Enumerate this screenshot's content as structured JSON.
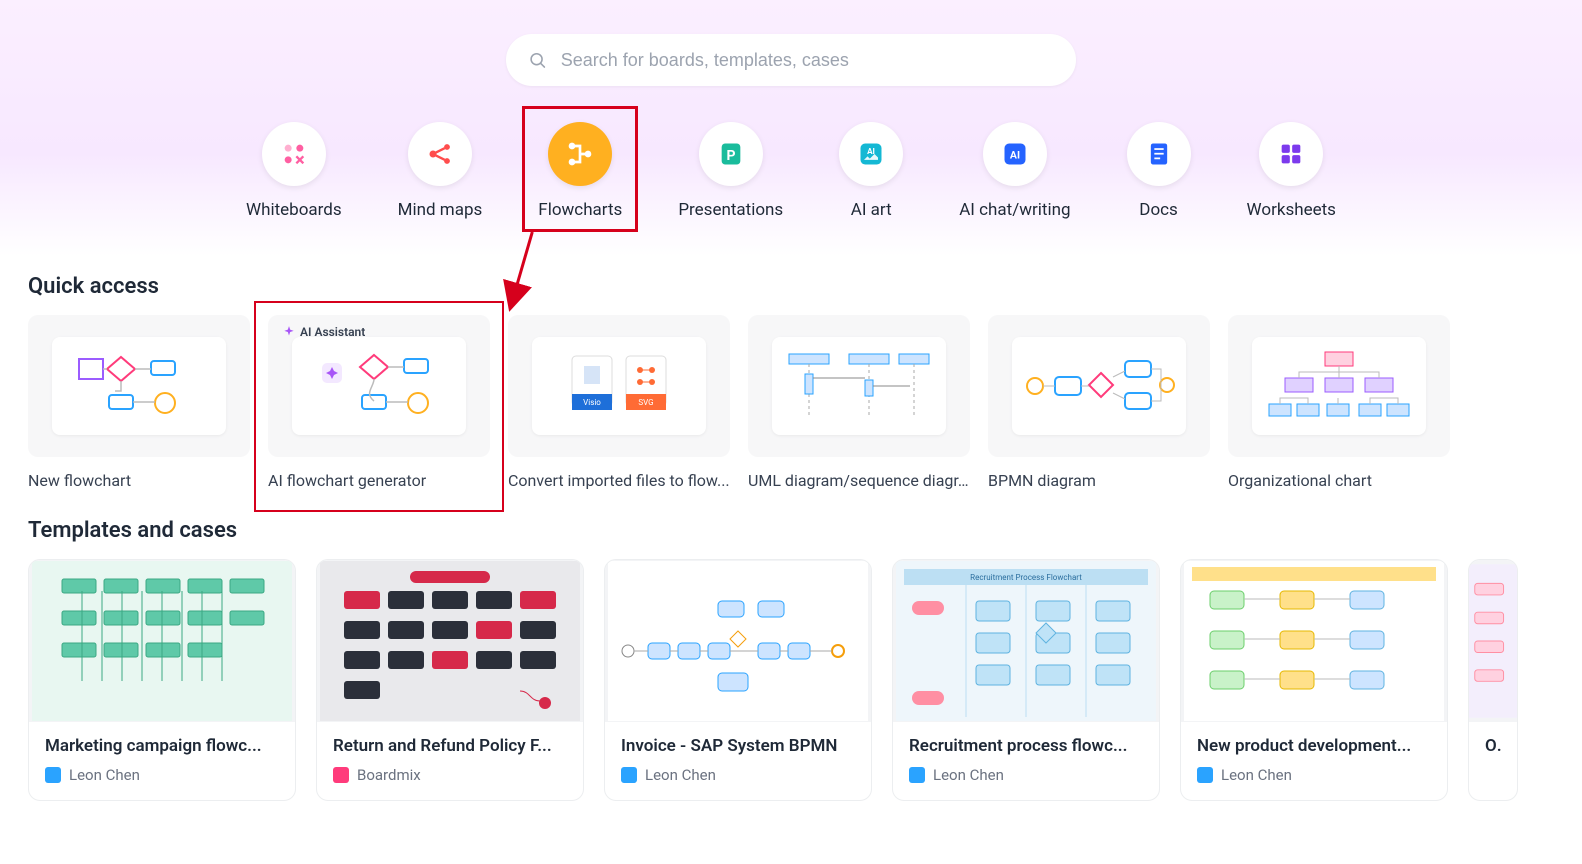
{
  "search": {
    "placeholder": "Search for boards, templates, cases"
  },
  "categories": [
    {
      "label": "Whiteboards",
      "id": "whiteboards",
      "icon": "grid",
      "color": "#ff5fa2"
    },
    {
      "label": "Mind maps",
      "id": "mindmaps",
      "icon": "share",
      "color": "#ff4d4d"
    },
    {
      "label": "Flowcharts",
      "id": "flowcharts",
      "icon": "flow",
      "color": "#ffffff",
      "active": true
    },
    {
      "label": "Presentations",
      "id": "presentations",
      "icon": "p",
      "color": "#1abc9c"
    },
    {
      "label": "AI art",
      "id": "ai-art",
      "icon": "ai-art",
      "color": "#14b8d4"
    },
    {
      "label": "AI chat/writing",
      "id": "ai-chat",
      "icon": "ai",
      "color": "#2563ff"
    },
    {
      "label": "Docs",
      "id": "docs",
      "icon": "doc",
      "color": "#2563ff"
    },
    {
      "label": "Worksheets",
      "id": "worksheets",
      "icon": "sheet",
      "color": "#7c3aed"
    }
  ],
  "quick_access": {
    "title": "Quick access",
    "items": [
      {
        "label": "New flowchart",
        "id": "new-flowchart"
      },
      {
        "label": "AI flowchart generator",
        "id": "ai-flowchart-generator",
        "ai_badge": "AI Assistant"
      },
      {
        "label": "Convert imported files to flow...",
        "id": "convert-import"
      },
      {
        "label": "UML diagram/sequence diagr...",
        "id": "uml"
      },
      {
        "label": "BPMN diagram",
        "id": "bpmn"
      },
      {
        "label": "Organizational chart",
        "id": "org-chart"
      }
    ]
  },
  "templates": {
    "title": "Templates and cases",
    "items": [
      {
        "title": "Marketing campaign flowc...",
        "author": "Leon Chen",
        "logo": "blue",
        "thumb": "teal"
      },
      {
        "title": "Return and Refund Policy F...",
        "author": "Boardmix",
        "logo": "pink",
        "thumb": "dark"
      },
      {
        "title": "Invoice - SAP System BPMN",
        "author": "Leon Chen",
        "logo": "blue",
        "thumb": "bpmn"
      },
      {
        "title": "Recruitment process flowc...",
        "author": "Leon Chen",
        "logo": "blue",
        "thumb": "recruit"
      },
      {
        "title": "New product development...",
        "author": "Leon Chen",
        "logo": "blue",
        "thumb": "product"
      },
      {
        "title": "Or...",
        "author": "",
        "logo": "blue",
        "thumb": "partial"
      }
    ]
  },
  "annotations": {
    "cat_highlight_index": 2,
    "qa_highlight_index": 1
  }
}
